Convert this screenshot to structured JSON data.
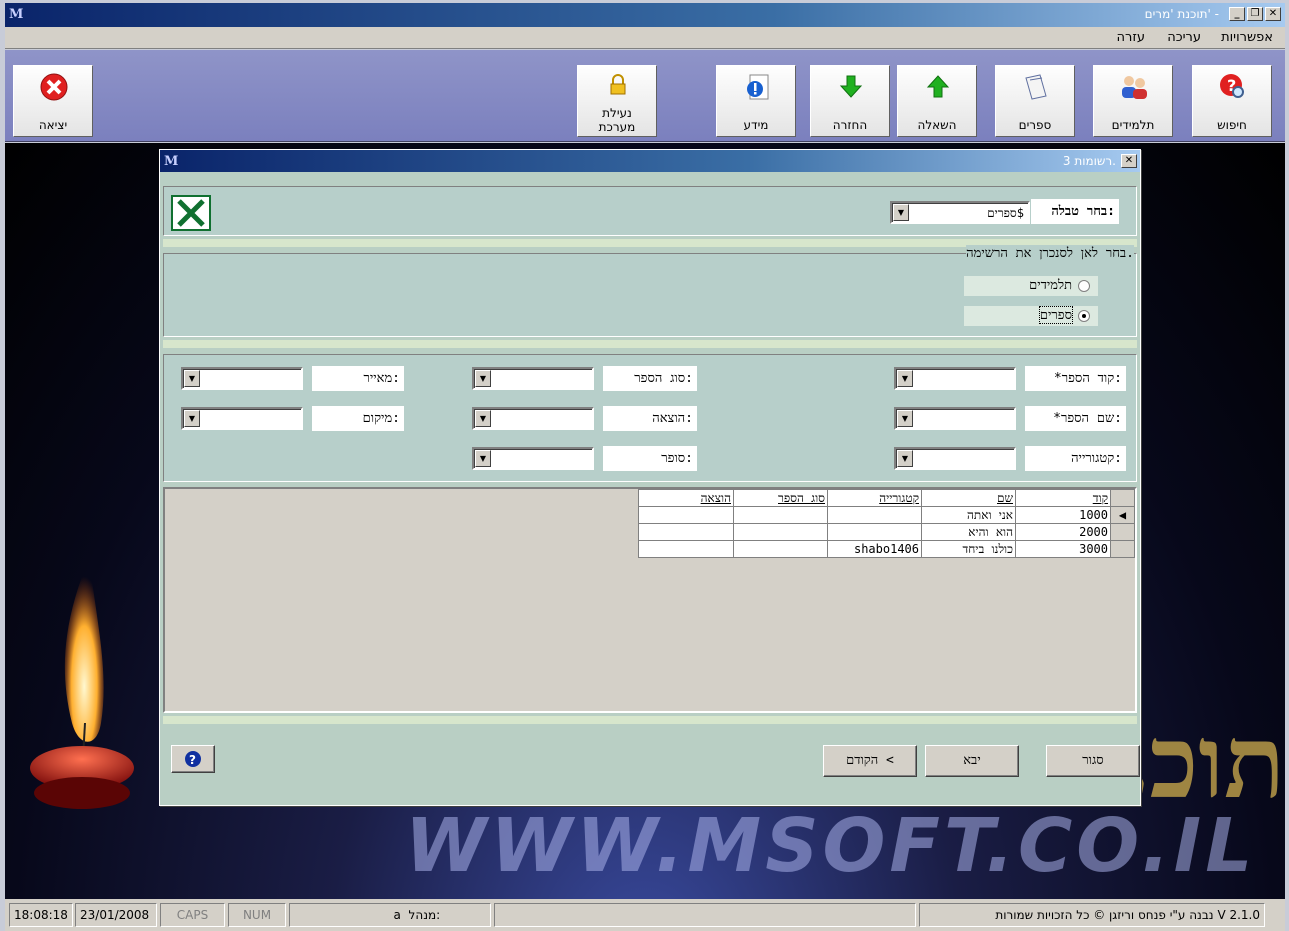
{
  "window": {
    "title": "תוכנת 'מרים' -",
    "app_glyph": "M"
  },
  "menu": [
    "אפשרויות",
    "עריכה",
    "עזרה"
  ],
  "toolbar": {
    "exit": "יציאה",
    "lock_line1": "נעילת",
    "lock_line2": "מערכת",
    "info": "מידע",
    "return": "החזרה",
    "borrow": "השאלה",
    "books": "ספרים",
    "students": "תלמידים",
    "search": "חיפוש"
  },
  "background": {
    "brand": "WWW.MSOFT.CO.IL",
    "hebrew": "תוכנ"
  },
  "dialog": {
    "title": "3 רשומות.",
    "select_table_label": "בחר טבלה:",
    "select_table_value": "ספרים$",
    "sync_group_label": "בחר לאן לסנכרן את הרשימה.",
    "radio_students": "תלמידים",
    "radio_books": "ספרים",
    "fields": {
      "book_code": "*קוד הספר:",
      "book_name": "*שם הספר:",
      "category": "קטגורייה:",
      "book_type": "סוג הספר:",
      "publisher": "הוצאה:",
      "author": "סופר:",
      "illustrator": "מאייר:",
      "location": "מיקום:"
    },
    "grid": {
      "columns": [
        "קוד",
        "שם",
        "קטגורייה",
        "סוג הספר",
        "הוצאה"
      ],
      "rows": [
        {
          "code": "1000",
          "name": "אני ואתה",
          "category": "",
          "type": "",
          "publisher": ""
        },
        {
          "code": "2000",
          "name": "הוא והיא",
          "category": "",
          "type": "",
          "publisher": ""
        },
        {
          "code": "3000",
          "name": "כולנו ביחד",
          "category": "shabo1406",
          "type": "",
          "publisher": ""
        }
      ]
    },
    "buttons": {
      "close": "סגור",
      "next": "יבא",
      "prev": "הקודם <"
    }
  },
  "status": {
    "time": "18:08:18",
    "date": "23/01/2008",
    "caps": "CAPS",
    "num": "NUM",
    "manager_label": "מנהל:",
    "manager_value": "a",
    "version": "V 2.1.0",
    "credits": "נבנה ע\"י פנחס וריזגן © כל הזכויות שמורות"
  }
}
